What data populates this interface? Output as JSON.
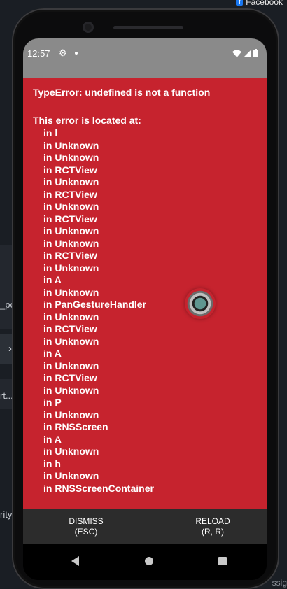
{
  "background": {
    "top_right_label": "Facebook",
    "side_labels": [
      "_po",
      "rt...",
      "rity"
    ],
    "side_chevron": "›",
    "bottom_right_label": "ssig"
  },
  "status_bar": {
    "time": "12:57",
    "icons": [
      "gear-icon",
      "dot-icon",
      "wifi-icon",
      "signal-icon",
      "battery-icon"
    ]
  },
  "error": {
    "title": "TypeError: undefined is not a function",
    "located_label": "This error is located at:",
    "stack": [
      "in l",
      "in Unknown",
      "in Unknown",
      "in RCTView",
      "in Unknown",
      "in RCTView",
      "in Unknown",
      "in RCTView",
      "in Unknown",
      "in Unknown",
      "in RCTView",
      "in Unknown",
      "in A",
      "in Unknown",
      "in PanGestureHandler",
      "in Unknown",
      "in RCTView",
      "in Unknown",
      "in A",
      "in Unknown",
      "in RCTView",
      "in Unknown",
      "in P",
      "in Unknown",
      "in RNSScreen",
      "in A",
      "in Unknown",
      "in h",
      "in Unknown",
      "in RNSScreenContainer"
    ],
    "background_color": "#c6232e"
  },
  "buttons": {
    "dismiss_line1": "DISMISS",
    "dismiss_line2": "(ESC)",
    "reload_line1": "RELOAD",
    "reload_line2": "(R, R)"
  }
}
